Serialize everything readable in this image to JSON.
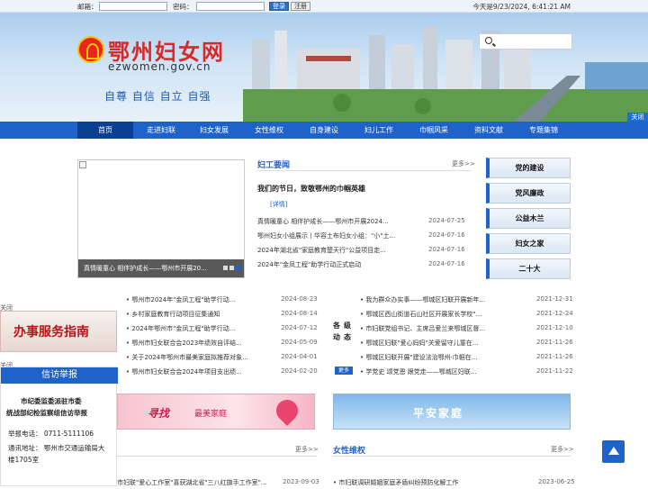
{
  "topbar": {
    "email_label": "邮箱：",
    "password_label": "密码：",
    "login": "登录",
    "register": "注册",
    "datetime": "今天是9/23/2024, 6:41:21 AM"
  },
  "header": {
    "site_name": "鄂州妇女网",
    "site_url": "ezwomen.gov.cn",
    "slogan": "自尊 自信 自立 自强",
    "close": "关闭"
  },
  "nav": [
    "首页",
    "走进妇联",
    "妇女发展",
    "女性维权",
    "自身建设",
    "妇儿工作",
    "巾帼风采",
    "资料文献",
    "专题集锦"
  ],
  "slider": {
    "caption": "真情暖童心 相伴护成长——鄂州市开展20..."
  },
  "fugong": {
    "title": "妇工要闻",
    "more": "更多>>",
    "headline": "我们的节日，致敬鄂州的巾帼英雄",
    "detail": "[详情]",
    "items": [
      {
        "t": "真情暖童心 相伴护成长——鄂州市开展2024...",
        "d": "2024-07-25"
      },
      {
        "t": "鄂州妇女小组展示丨华容土布妇女小组：\"小\"土...",
        "d": "2024-07-16"
      },
      {
        "t": "2024年湖北省\"家庭教育楚天行\"公益项目走...",
        "d": "2024-07-16"
      },
      {
        "t": "2024年\"金凤工程\"助学行动正式启动",
        "d": "2024-07-16"
      }
    ]
  },
  "right_boxes": [
    "党的建设",
    "党风廉政",
    "公益木兰",
    "妇女之家",
    "二十大"
  ],
  "list_left": [
    {
      "t": "鄂州市2024年\"金凤工程\"助学行动...",
      "d": "2024-08-23"
    },
    {
      "t": "乡村家庭教育行动项目征集通知",
      "d": "2024-08-14"
    },
    {
      "t": "2024年鄂州市\"金凤工程\"助学行动...",
      "d": "2024-07-12"
    },
    {
      "t": "鄂州市妇女联合会2023年绩效自评结...",
      "d": "2024-05-09"
    },
    {
      "t": "关于2024年鄂州市最美家庭拟推荐对象...",
      "d": "2024-04-01"
    },
    {
      "t": "鄂州市妇女联合会2024年项目支出绩...",
      "d": "2024-02-20"
    }
  ],
  "mid_label": "各级动态",
  "mid_more": "更多",
  "list_right": [
    {
      "t": "我为群众办实事——鄂城区妇联开展新年...",
      "d": "2021-12-31"
    },
    {
      "t": "鄂城区西山街道石山社区开展家长学校\"...",
      "d": "2021-12-24"
    },
    {
      "t": "市妇联党组书记、主席吕爱兰来鄂城区督...",
      "d": "2021-12-10"
    },
    {
      "t": "鄂城区妇联\"爱心妈妈\"关爱留守儿童在...",
      "d": "2021-11-26"
    },
    {
      "t": "鄂城区妇联开展\"建设法治鄂州·巾帼在...",
      "d": "2021-11-26"
    },
    {
      "t": "学党史 颂党恩 跟党走——鄂城区妇联...",
      "d": "2021-11-22"
    }
  ],
  "float_left": {
    "close1": "关闭",
    "guide": "办事服务指南",
    "close2": "关闭",
    "report_title": "信访举报",
    "org1": "市纪委监委派驻市委",
    "org2": "统战部纪检监察组信访举报",
    "phone": "举报电话：  0711-5111106",
    "addr1": "通讯地址：  鄂州市交通运输局大",
    "addr2": "楼1705室"
  },
  "ads": {
    "left_1": "寻找",
    "left_2": "最美家庭",
    "right": "平安家庭"
  },
  "bottom": {
    "left_more": "更多>>",
    "right_title": "女性维权",
    "right_more": "更多>>",
    "left_item": {
      "t": "市妇联\"爱心工作室\"喜获湖北省\"三八红旗手工作室\"...",
      "d": "2023-09-03"
    },
    "right_item": {
      "t": "市妇联调研婚姻家庭矛盾纠纷预防化解工作",
      "d": "2023-06-25"
    }
  },
  "colors": {
    "primary": "#1f62c9",
    "brand_red": "#d92a2a"
  }
}
